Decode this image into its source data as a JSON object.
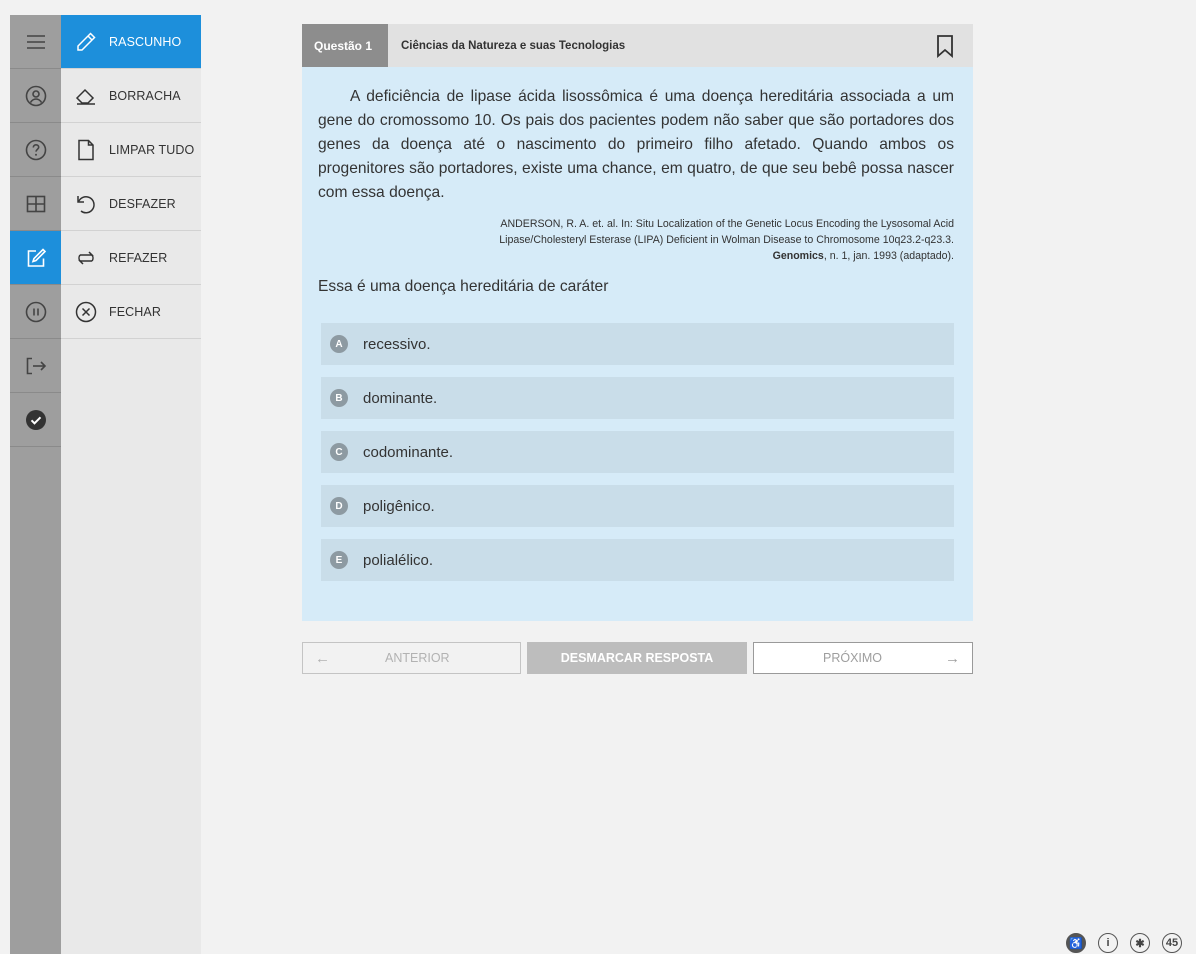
{
  "rail": {
    "items": [
      "menu-icon",
      "user-icon",
      "help-icon",
      "layout-icon",
      "draft-icon",
      "pause-icon",
      "exit-icon",
      "check-icon"
    ],
    "active_index": 4
  },
  "tools": {
    "items": [
      {
        "label": "RASCUNHO",
        "icon": "pencil-icon"
      },
      {
        "label": "BORRACHA",
        "icon": "eraser-icon"
      },
      {
        "label": "LIMPAR TUDO",
        "icon": "blank-page-icon"
      },
      {
        "label": "DESFAZER",
        "icon": "undo-icon"
      },
      {
        "label": "REFAZER",
        "icon": "redo-icon"
      },
      {
        "label": "FECHAR",
        "icon": "close-circle-icon"
      }
    ]
  },
  "question": {
    "number_label": "Questão 1",
    "area": "Ciências da Natureza e suas Tecnologias",
    "text": "A deficiência de lipase ácida lisossômica é uma doença hereditária associada a um gene do cromossomo 10. Os pais dos pacientes podem não saber que são portadores dos genes da doença até o nascimento do primeiro filho afetado. Quando ambos os progenitores são portadores, existe uma chance, em quatro, de que seu bebê possa nascer com essa doença.",
    "reference_part1": "ANDERSON, R. A. et. al. In: Situ Localization of the Genetic Locus Encoding the Lysosomal Acid Lipase/Cholesteryl Esterase (LIPA) Deficient in Wolman Disease to Chromosome 10q23.2-q23.3. ",
    "reference_bold": "Genomics",
    "reference_part2": ", n. 1, jan. 1993 (adaptado).",
    "prompt": "Essa é uma doença hereditária de caráter",
    "options": [
      {
        "letter": "A",
        "text": "recessivo."
      },
      {
        "letter": "B",
        "text": "dominante."
      },
      {
        "letter": "C",
        "text": "codominante."
      },
      {
        "letter": "D",
        "text": "poligênico."
      },
      {
        "letter": "E",
        "text": "polialélico."
      }
    ]
  },
  "nav": {
    "prev_arrow": "←",
    "prev_label": "ANTERIOR",
    "clear_label": "DESMARCAR RESPOSTA",
    "next_label": "PRÓXIMO",
    "next_arrow": "→"
  },
  "accessibility": {
    "items": [
      {
        "icon": "accessibility-icon",
        "text": "♿"
      },
      {
        "icon": "info-icon",
        "text": "i"
      },
      {
        "icon": "bug-icon",
        "text": "✱"
      },
      {
        "icon": "counter-icon",
        "text": "45"
      }
    ]
  },
  "colors": {
    "accent": "#1d8fdb",
    "card_bg": "#d6ebf8",
    "option_bg": "#c9dde9",
    "rail_bg": "#9e9e9e",
    "panel_bg": "#e9e9e9"
  }
}
